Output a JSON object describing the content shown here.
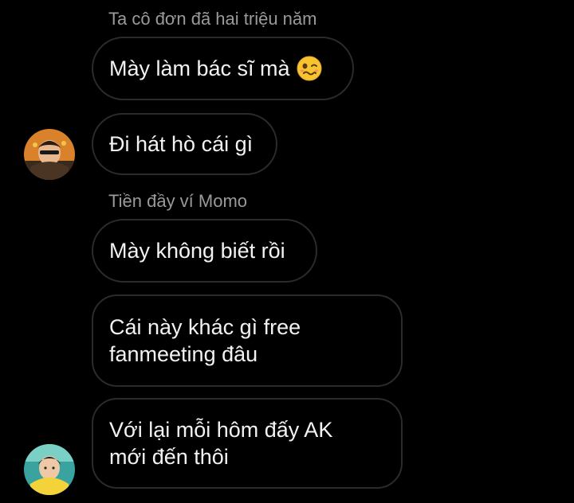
{
  "messages": [
    {
      "sender": "Ta cô đơn đã hai triệu năm",
      "text": "Mày làm bác sĩ mà",
      "emoji": "woozy-face-icon"
    },
    {
      "text": "Đi hát hò cái gì"
    },
    {
      "sender": "Tiền đầy ví Momo",
      "text": "Mày không biết rồi"
    },
    {
      "text": "Cái này khác gì free fanmeeting đâu"
    },
    {
      "text": "Với lại mỗi hôm đấy AK mới đến thôi"
    }
  ],
  "avatars": [
    {
      "name": "avatar-orange-photo",
      "accent": "#d9822b"
    },
    {
      "name": "avatar-teal-photo",
      "accent": "#3aa3a0"
    }
  ],
  "colors": {
    "background": "#000000",
    "bubble_border": "#2b2b2b",
    "text": "#f2f2f2",
    "sender_name": "#9a9a9a"
  }
}
